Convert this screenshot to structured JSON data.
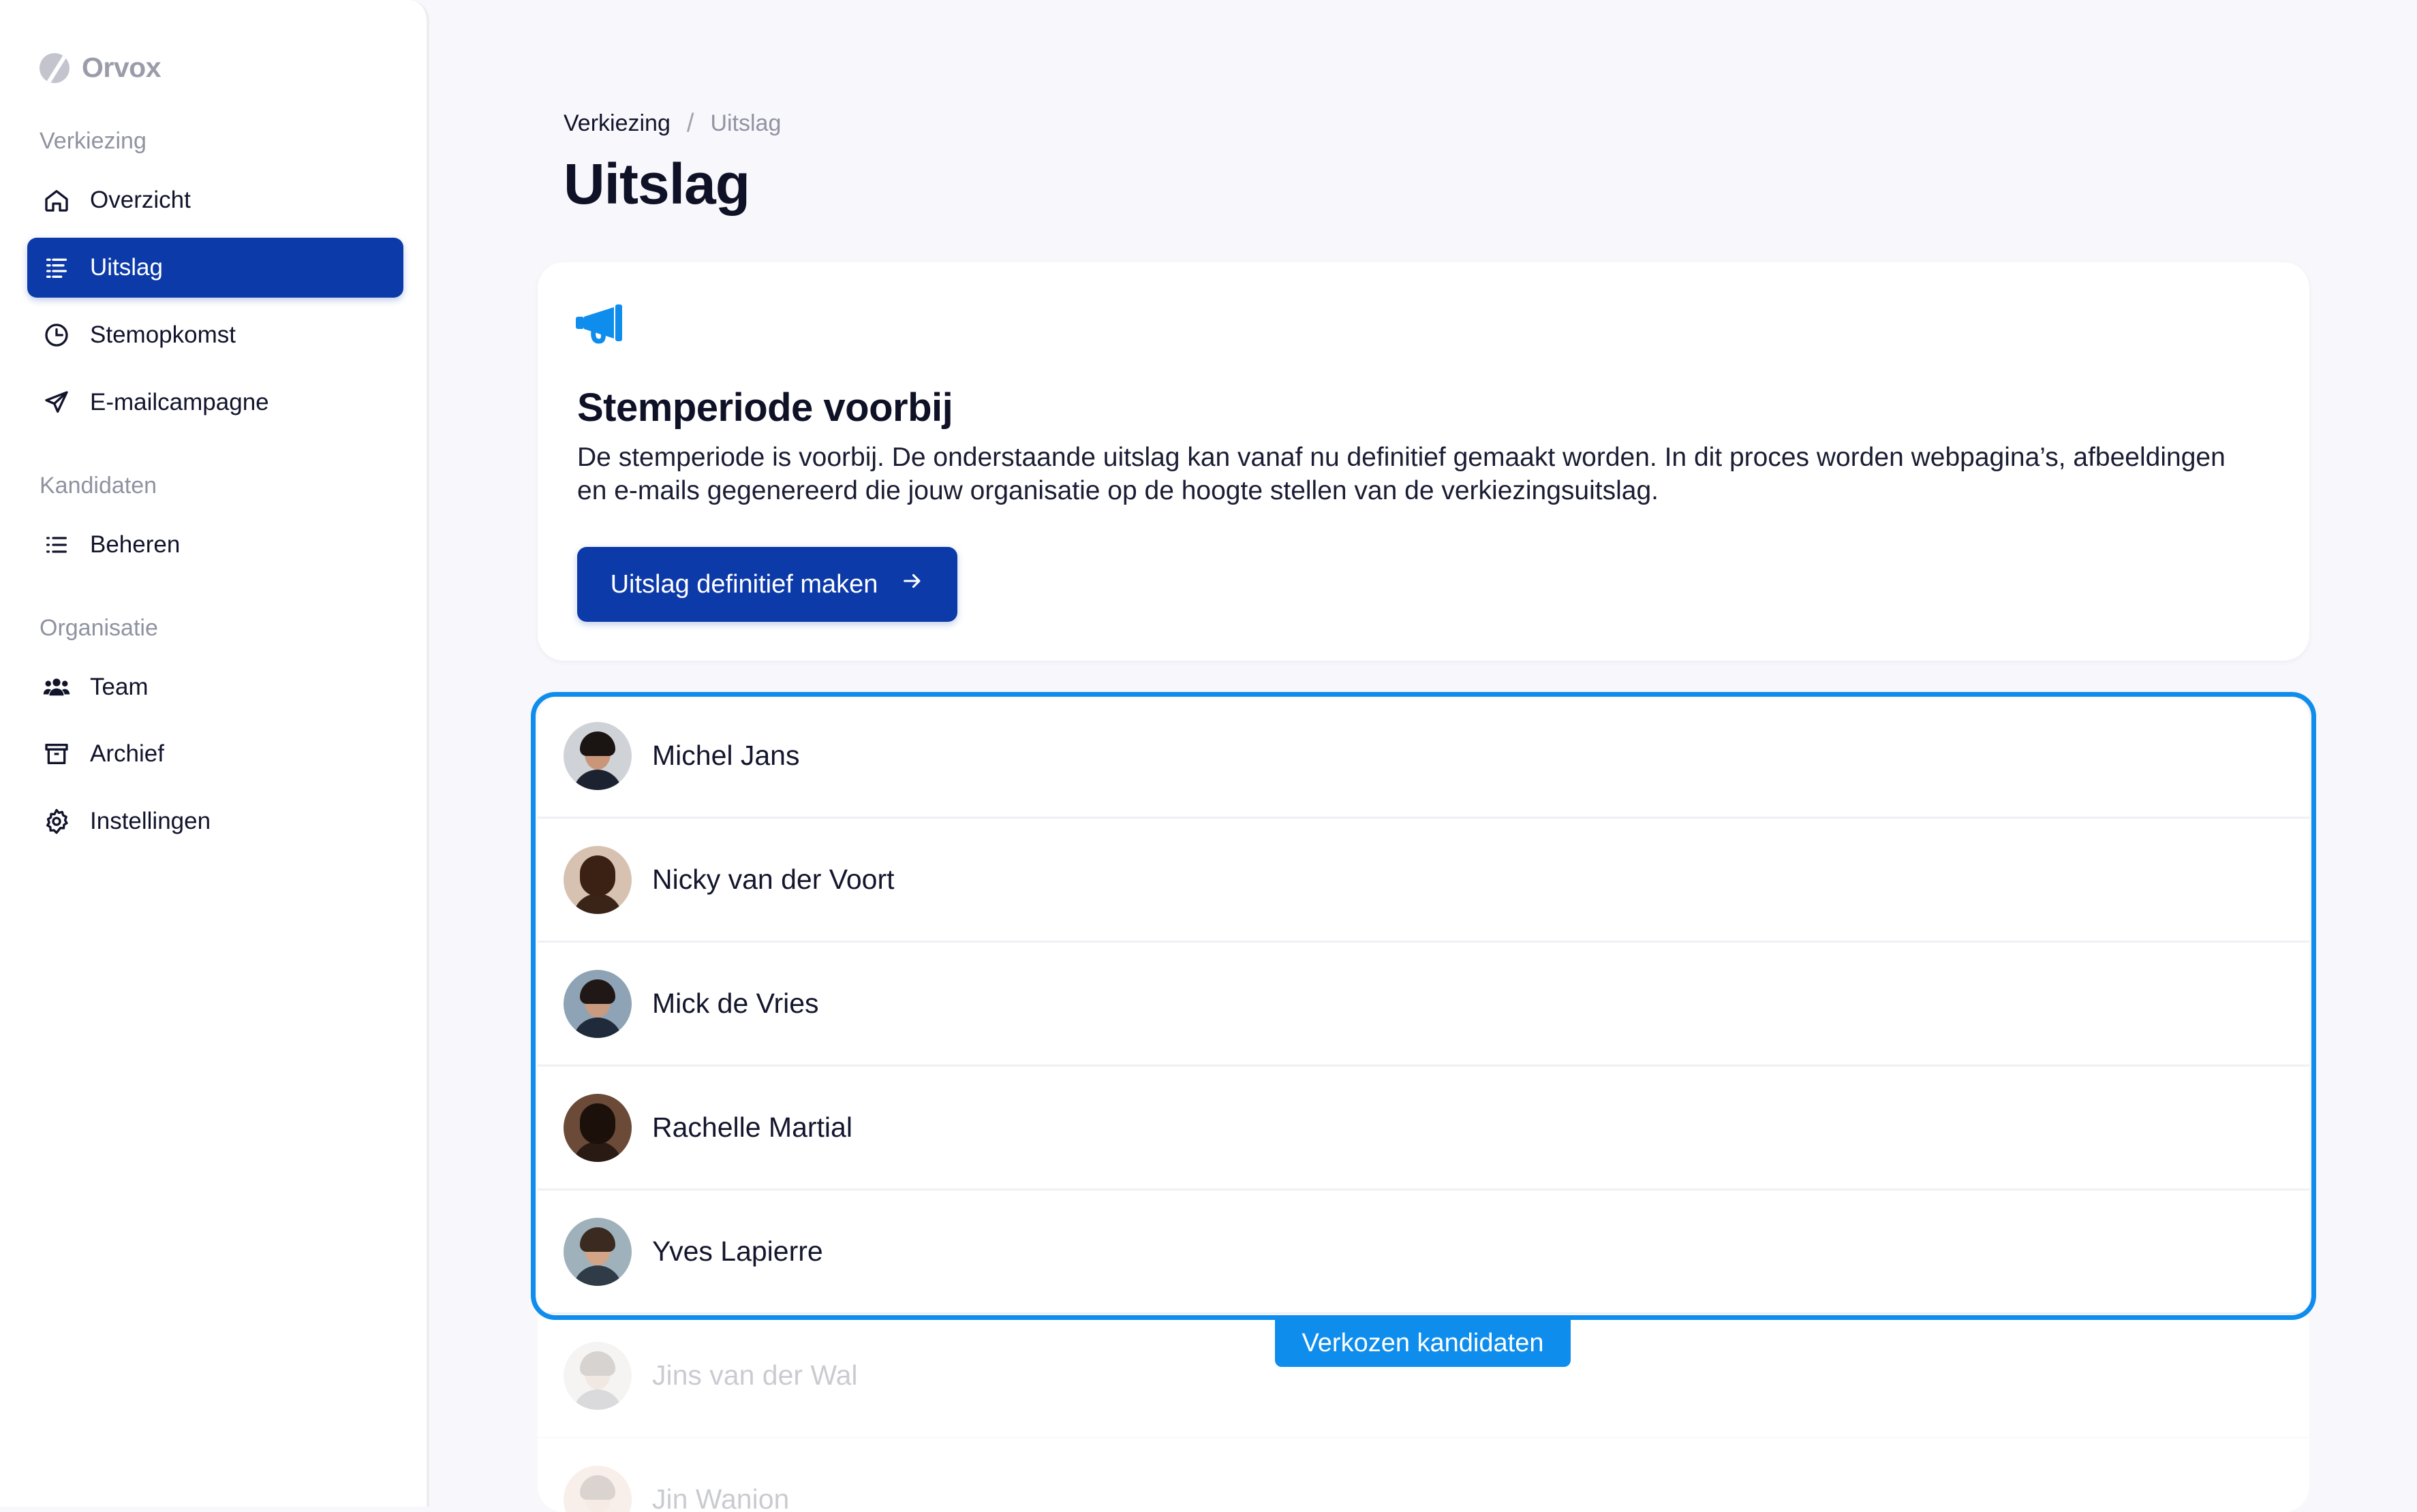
{
  "app": {
    "name": "Orvox"
  },
  "sidebar": {
    "sections": [
      {
        "title": "Verkiezing"
      },
      {
        "title": "Kandidaten"
      },
      {
        "title": "Organisatie"
      }
    ],
    "items": [
      {
        "label": "Overzicht",
        "icon": "home-icon",
        "active": false
      },
      {
        "label": "Uitslag",
        "icon": "list-icon",
        "active": true
      },
      {
        "label": "Stemopkomst",
        "icon": "clock-icon",
        "active": false
      },
      {
        "label": "E-mailcampagne",
        "icon": "send-icon",
        "active": false
      },
      {
        "label": "Beheren",
        "icon": "bullet-list-icon",
        "active": false
      },
      {
        "label": "Team",
        "icon": "users-icon",
        "active": false
      },
      {
        "label": "Archief",
        "icon": "archive-icon",
        "active": false
      },
      {
        "label": "Instellingen",
        "icon": "gear-icon",
        "active": false
      }
    ]
  },
  "breadcrumb": {
    "parent": "Verkiezing",
    "separator": "/",
    "current": "Uitslag"
  },
  "page": {
    "title": "Uitslag"
  },
  "notice": {
    "icon": "megaphone-icon",
    "title": "Stemperiode voorbij",
    "body": "De stemperiode is voorbij. De onderstaande uitslag kan vanaf nu definitief gemaakt worden. In dit proces worden webpagina’s, afbeeldingen en e-mails gegenereerd die jouw organisatie op de hoogte stellen van de verkiezingsuitslag.",
    "button_label": "Uitslag definitief maken",
    "button_icon": "arrow-right-icon"
  },
  "candidates": [
    {
      "name": "Michel Jans",
      "elected": true
    },
    {
      "name": "Nicky van der Voort",
      "elected": true
    },
    {
      "name": "Mick de Vries",
      "elected": true
    },
    {
      "name": "Rachelle Martial",
      "elected": true
    },
    {
      "name": "Yves Lapierre",
      "elected": true
    },
    {
      "name": "Jins van der Wal",
      "elected": false
    },
    {
      "name": "Jin Wanion",
      "elected": false
    }
  ],
  "elected_label": "Verkozen kandidaten",
  "colors": {
    "accent": "#0c3aa8",
    "highlight": "#0f8ded",
    "background": "#f8f7fc"
  }
}
